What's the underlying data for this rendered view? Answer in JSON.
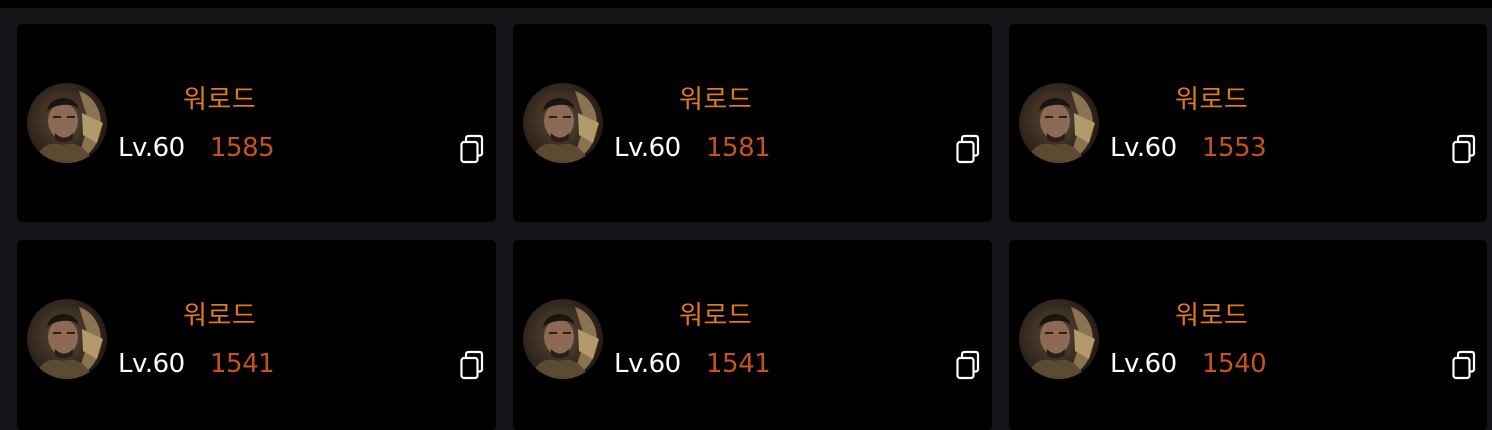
{
  "cards": [
    {
      "class_name": "워로드",
      "level": "Lv.60",
      "item_level": "1585",
      "avatar": "warlord-portrait",
      "action_icon": "copy-icon"
    },
    {
      "class_name": "워로드",
      "level": "Lv.60",
      "item_level": "1581",
      "avatar": "warlord-portrait",
      "action_icon": "copy-icon"
    },
    {
      "class_name": "워로드",
      "level": "Lv.60",
      "item_level": "1553",
      "avatar": "warlord-portrait",
      "action_icon": "copy-icon"
    },
    {
      "class_name": "워로드",
      "level": "Lv.60",
      "item_level": "1541",
      "avatar": "warlord-portrait",
      "action_icon": "copy-icon"
    },
    {
      "class_name": "워로드",
      "level": "Lv.60",
      "item_level": "1541",
      "avatar": "warlord-portrait",
      "action_icon": "copy-icon"
    },
    {
      "class_name": "워로드",
      "level": "Lv.60",
      "item_level": "1540",
      "avatar": "warlord-portrait",
      "action_icon": "copy-icon"
    }
  ],
  "colors": {
    "page_background": "#141418",
    "card_background": "#000000",
    "class_name": "#e07a18",
    "level": "#ffffff",
    "item_level": "#c7521b"
  }
}
